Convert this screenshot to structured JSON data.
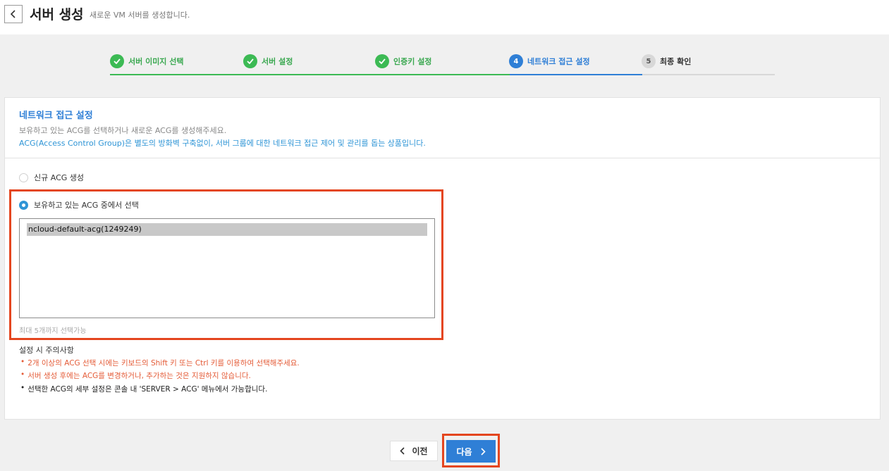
{
  "header": {
    "title": "서버 생성",
    "subtitle": "새로운 VM 서버를 생성합니다."
  },
  "steps": [
    {
      "number": "1",
      "label": "서버 이미지 선택",
      "state": "done"
    },
    {
      "number": "2",
      "label": "서버 설정",
      "state": "done"
    },
    {
      "number": "3",
      "label": "인증키 설정",
      "state": "done"
    },
    {
      "number": "4",
      "label": "네트워크 접근 설정",
      "state": "active"
    },
    {
      "number": "5",
      "label": "최종 확인",
      "state": "todo"
    }
  ],
  "section": {
    "title": "네트워크 접근 설정",
    "description": "보유하고 있는 ACG를 선택하거나 새로운 ACG를 생성해주세요.",
    "info": "ACG(Access Control Group)은 별도의 방화벽 구축없이, 서버 그룹에 대한 네트워크 접근 제어 및 관리를 돕는 상품입니다."
  },
  "options": {
    "new_acg": {
      "label": "신규 ACG 생성",
      "checked": false
    },
    "existing_acg": {
      "label": "보유하고 있는 ACG 중에서 선택",
      "checked": true
    }
  },
  "acg_list": {
    "items": [
      "ncloud-default-acg(1249249)"
    ],
    "selected": "ncloud-default-acg(1249249)",
    "limit_note": "최대 5개까지 선택가능"
  },
  "notes": {
    "title": "설정 시 주의사항",
    "bullet": "•",
    "items": [
      {
        "text": "2개 이상의 ACG 선택 시에는 키보드의 Shift 키 또는 Ctrl 키를 이용하여 선택해주세요.",
        "type": "warn"
      },
      {
        "text": "서버 생성 후에는 ACG를 변경하거나, 추가하는 것은 지원하지 않습니다.",
        "type": "warn"
      },
      {
        "text": "선택한 ACG의 세부 설정은 콘솔 내 'SERVER > ACG' 메뉴에서 가능합니다.",
        "type": "plain"
      }
    ]
  },
  "buttons": {
    "prev": "이전",
    "next": "다음"
  },
  "colors": {
    "accent": "#2f7fd6",
    "done": "#3cba54",
    "warning": "#e45b37",
    "highlight": "#e4461f"
  }
}
